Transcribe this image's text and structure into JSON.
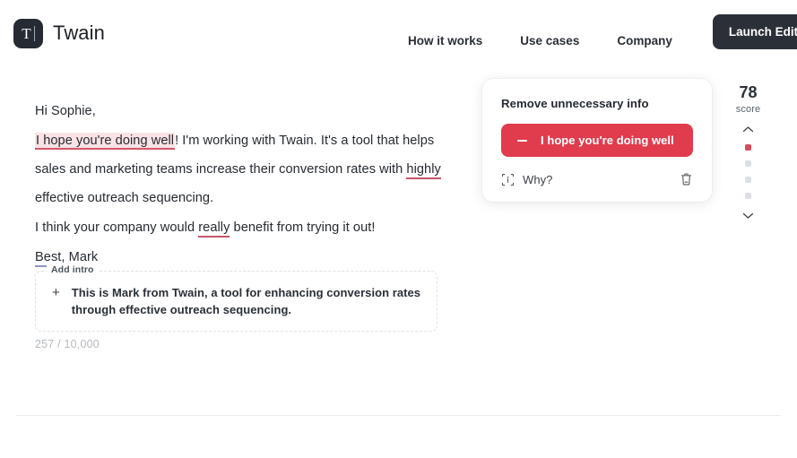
{
  "header": {
    "brand_name": "Twain",
    "logo_letter": "T",
    "nav": [
      {
        "label": "How it works"
      },
      {
        "label": "Use cases"
      },
      {
        "label": "Company"
      }
    ],
    "cta_label": "Launch Editor"
  },
  "editor": {
    "greeting": "Hi Sophie,",
    "paragraph1": {
      "highlight": "I hope you're doing well",
      "after_highlight": "! I'm working with Twain. It's a tool that helps sales and marketing teams increase their conversion rates with ",
      "underlined_word": "highly",
      "tail": " effective outreach sequencing."
    },
    "paragraph2": {
      "before": "I think your company would ",
      "underlined_word": "really",
      "after": " benefit from trying it out!"
    },
    "signoff": {
      "underlined_word": "Best",
      "rest": ", Mark"
    },
    "intro_card": {
      "label": "Add intro",
      "plus": "+",
      "text": "This is Mark from Twain, a tool for enhancing conversion rates through effective outreach sequencing."
    },
    "counter": "257 / 10,000"
  },
  "suggestion": {
    "title": "Remove unnecessary info",
    "action_label": "I hope you're doing well",
    "action_icon": "minus-icon",
    "why_label": "Why?",
    "why_icon": "info-scan-icon",
    "delete_icon": "trash-icon",
    "accent_color": "#e03c4e"
  },
  "score": {
    "value": "78",
    "label": "score",
    "up_icon": "chevron-up-icon",
    "down_icon": "chevron-down-icon",
    "indicators": [
      {
        "state": "active"
      },
      {
        "state": "inactive"
      },
      {
        "state": "inactive"
      },
      {
        "state": "inactive"
      }
    ],
    "active_color": "#d94a5c",
    "inactive_color": "#dcdfe3"
  },
  "highlight_colors": {
    "remove_background": "#fae3e6",
    "remove_underline": "#d6566a",
    "word_underline_red": "#c2566b",
    "word_underline_blue": "#8a94c4"
  }
}
